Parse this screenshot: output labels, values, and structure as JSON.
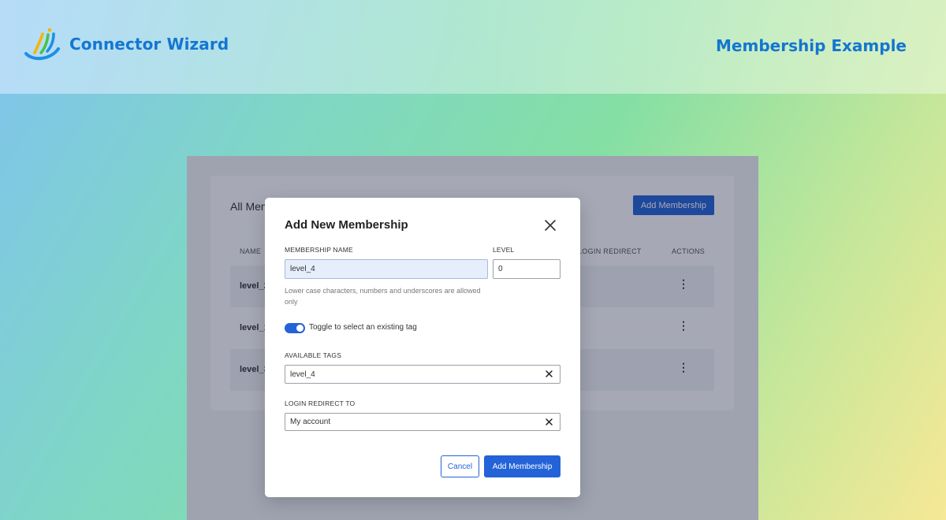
{
  "header": {
    "brand_name": "Connector Wizard",
    "brand_icon": "connector-wizard-logo",
    "page_heading": "Membership Example"
  },
  "background_page": {
    "card_title": "All Mem",
    "add_button_label": "Add Membership",
    "columns": [
      "NAME",
      "LOGIN REDIRECT",
      "ACTIONS"
    ],
    "rows": [
      {
        "name": "level_2",
        "actions_icon": "kebab-menu-icon"
      },
      {
        "name": "level_1",
        "actions_icon": "kebab-menu-icon"
      },
      {
        "name": "level_3",
        "actions_icon": "kebab-menu-icon"
      }
    ]
  },
  "modal": {
    "title": "Add New Membership",
    "close_icon": "close-icon",
    "membership_name_label": "MEMBERSHIP NAME",
    "membership_name_value": "level_4",
    "level_label": "LEVEL",
    "level_value": "0",
    "help_text": "Lower case characters, numbers and underscores are allowed only",
    "toggle_label": "Toggle to select an existing tag",
    "toggle_on": true,
    "available_tags_label": "AVAILABLE TAGS",
    "available_tags_value": "level_4",
    "login_redirect_label": "LOGIN REDIRECT TO",
    "login_redirect_value": "My account",
    "cancel_label": "Cancel",
    "submit_label": "Add Membership"
  },
  "colors": {
    "accent": "#2463d7",
    "brand": "#1476d2"
  }
}
